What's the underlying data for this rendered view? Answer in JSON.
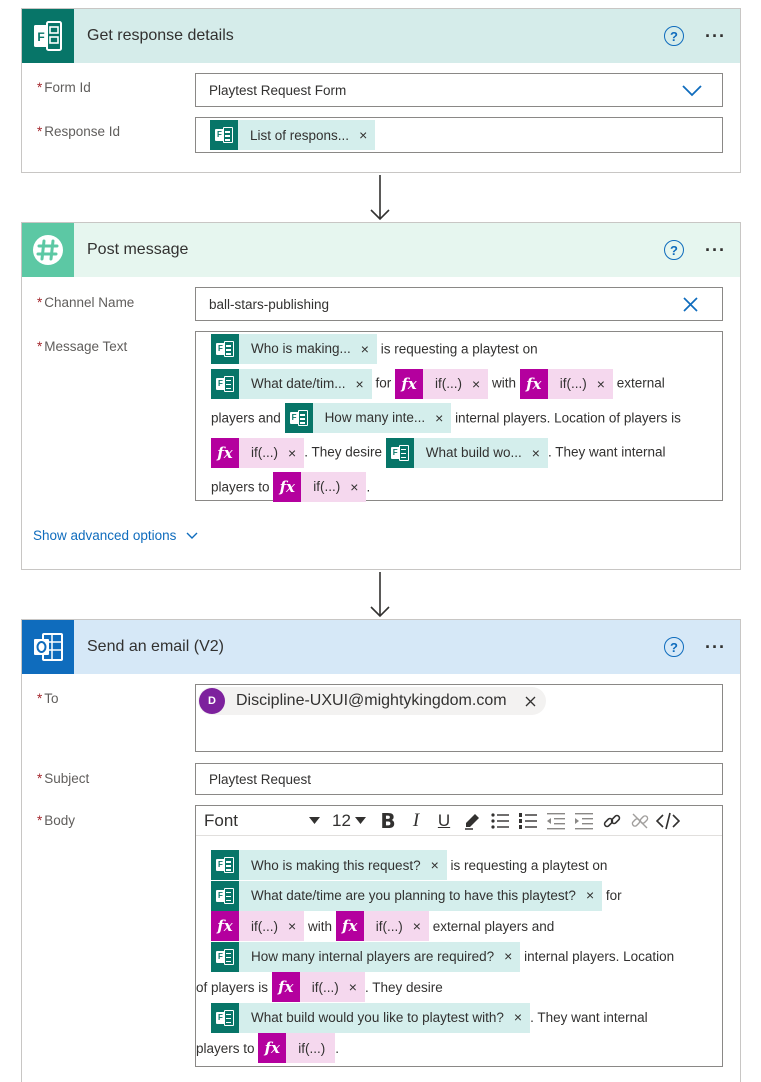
{
  "get_response": {
    "title": "Get response details",
    "form_id_label": "Form Id",
    "form_id_value": "Playtest Request Form",
    "response_id_label": "Response Id",
    "response_id_token": "List of respons..."
  },
  "post_message": {
    "title": "Post message",
    "channel_label": "Channel Name",
    "channel_value": "ball-stars-publishing",
    "message_label": "Message Text",
    "tokens": {
      "who": "Who is making...",
      "date": "What date/tim...",
      "if": "if(...)",
      "how_many": "How many inte...",
      "build": "What build wo..."
    },
    "text": {
      "requesting": "is requesting a playtest on",
      "for": "for",
      "with": "with",
      "external": "external",
      "players_and": "players and",
      "internal_players": "internal players. Location of players is",
      "they_desire": ". They desire",
      "they_want": ". They want internal",
      "players_to": "players to",
      "period": "."
    },
    "advanced": "Show advanced options"
  },
  "send_email": {
    "title": "Send an email (V2)",
    "to_label": "To",
    "to_avatar": "D",
    "to_value": "Discipline-UXUI@mightykingdom.com",
    "subject_label": "Subject",
    "subject_value": "Playtest Request",
    "body_label": "Body",
    "toolbar": {
      "font": "Font",
      "size": "12"
    },
    "tokens": {
      "who": "Who is making this request?",
      "date": "What date/time are you planning to have this playtest?",
      "if": "if(...)",
      "how_many": "How many internal players are required?",
      "build": "What build would you like to playtest with?"
    },
    "text": {
      "requesting": "is requesting a playtest on",
      "for": "for",
      "with": "with",
      "external": "external players and",
      "internal": "internal players. Location",
      "of_players_is": "of players is",
      "they_desire": ". They desire",
      "they_want": ". They want internal",
      "players_to": "players to",
      "period": "."
    }
  },
  "colors": {
    "forms_teal": "#077568",
    "slack_green": "#5cc8a4",
    "outlook_blue": "#0f6cbd",
    "fx_magenta": "#b4009e"
  }
}
